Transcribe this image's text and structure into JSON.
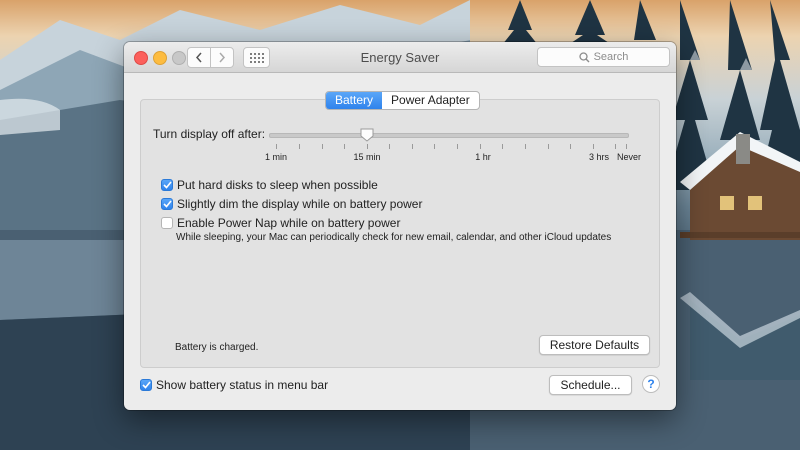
{
  "window": {
    "title": "Energy Saver",
    "search_placeholder": "Search"
  },
  "tabs": [
    {
      "label": "Battery",
      "active": true
    },
    {
      "label": "Power Adapter",
      "active": false
    }
  ],
  "slider": {
    "label": "Turn display off after:",
    "value": "15 min",
    "tick_labels": [
      "1 min",
      "15 min",
      "1 hr",
      "3 hrs",
      "Never"
    ]
  },
  "options": [
    {
      "label": "Put hard disks to sleep when possible",
      "checked": true
    },
    {
      "label": "Slightly dim the display while on battery power",
      "checked": true
    },
    {
      "label": "Enable Power Nap while on battery power",
      "checked": false
    }
  ],
  "power_nap_note": "While sleeping, your Mac can periodically check for new email, calendar, and other iCloud updates",
  "status_text": "Battery is charged.",
  "buttons": {
    "restore_defaults": "Restore Defaults",
    "schedule": "Schedule...",
    "help": "?"
  },
  "show_status": {
    "label": "Show battery status in menu bar",
    "checked": true
  },
  "colors": {
    "accent": "#2f83ec",
    "close": "#fc605c",
    "minimize": "#fdbc40"
  },
  "icons": [
    "search-icon",
    "chevron-left-icon",
    "chevron-right-icon",
    "grid-icon",
    "checkmark-icon",
    "help-icon"
  ]
}
